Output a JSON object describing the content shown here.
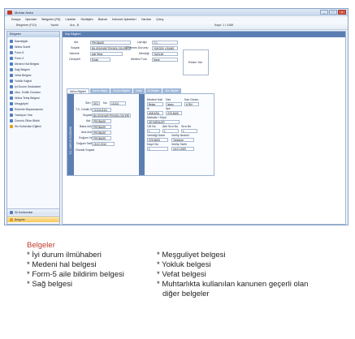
{
  "window": {
    "title": "Muhtar Arsivi",
    "min_label": "_",
    "max_label": "□",
    "close_label": "x"
  },
  "menu": [
    "Dosya",
    "İşlemler",
    "Belgeler (F6)",
    "Listeler",
    "Sicilişlim",
    "Bakım",
    "İnternet İşlemleri",
    "Yardım",
    "Çıkış"
  ],
  "toolbar": {
    "item1": "Belgelere (F10)",
    "item2": "Yazdır",
    "item3": "Ara - B",
    "record": "Kayıt: 1 / 4189"
  },
  "left_pane": {
    "title": "Belgeler",
    "items": [
      "İkametgah",
      "Nüfus Sureti",
      "Form-5",
      "Form-2",
      "Medeni Hal Belgesi",
      "Sağ Belgesi",
      "Vefat Belgesi",
      "Yoklük Kağıdı",
      "İyi Durum İlmuhaberi",
      "Ulus. Evlilik Cüzdanı",
      "Nüfus Tebiş Belgesi",
      "Meşguliyet",
      "Erkenlie Beyannamesi",
      "Yardayıcı Yazı",
      "Zorunlu Ölüm Bildiri",
      "Sin Kullanılan Eğitimi"
    ],
    "bottom1": "Sil Kullanımlar",
    "bottom2": "Belgeler"
  },
  "main": {
    "header": "Kişi Bilgileri",
    "labels": {
      "ad": "Adı",
      "soyadi": "Soyadı",
      "yakinlik": "Yakınlık",
      "cinsiyeti": "Cinsiyeti",
      "uyruk": "Uyruğu",
      "ogrenim": "Öğrenim Durumu",
      "meslek": "Mesleği",
      "medeni": "Medeni Turu"
    },
    "values": {
      "ad": "PROBASE",
      "soyadi": "BİLGİSAYAR/TEKNOLOJİLERİ",
      "yakinlik": "Aile Reisi",
      "cinsiyeti": "Erkek",
      "uyruk": "T.C.",
      "ogrenim": "YÜKSEK LİSANS",
      "meslek": "YAZILIM",
      "medeni": "Hane"
    },
    "photo_label": "Resim Yok",
    "tabs": [
      "Nüfus Bilgileri",
      "Adres Bilgisi",
      "Seçim Bilgileri",
      "Vefat",
      "Ek Bilgiler",
      "Aile Bilgileri"
    ]
  },
  "nufus": {
    "strip_left": "T.C. NÜFUS CÜZDANI",
    "labels": {
      "seri": "Seri",
      "no": "No",
      "tckimlik": "T.C. Kimlik No",
      "soyadi": "Soyadı",
      "adi": "Adı",
      "baba": "Baba Adı",
      "ana": "Ana Adı",
      "dogum_yeri": "Doğum Yeri",
      "dogum_tarihi": "Doğum Tarihi",
      "onceki": "Önceki Soyadı",
      "medeni": "Medeni Hali",
      "dini": "Dini",
      "kan": "Kan Grubu",
      "il": "İli",
      "ilce": "İlçe",
      "mahalle": "Mahalle / Köyü",
      "cilt": "Cilt No",
      "aile_sira": "Aile Sıra No",
      "sira": "Sıra No",
      "verildigi": "Verildiği Daire",
      "verilis": "Veriliş Nedeni",
      "kayit": "Kayıt No",
      "verilis_tarihi": "Veriliş Tarihi"
    },
    "values": {
      "seri": "G01",
      "no": "111111",
      "tckimlik": "11111111111",
      "soyadi": "BİLGİSAYAR/TEKNOLOJİLERİ",
      "adi": "PROBASE",
      "baba": "PROBASE",
      "ana": "PROBASE",
      "dogum_yeri": "PROBASE",
      "dogum_tarihi": "15.02.2010",
      "medeni": "Bekar",
      "dini": "İslam",
      "kan": "A Rh+",
      "il": "ANKARA",
      "ilce": "GÖLBAŞI",
      "mahalle": "SEYMENLER",
      "cilt": "1",
      "aile_sira": "1",
      "sira": "1",
      "verildigi": "GÖLBAŞI",
      "verilis": "Yenileme",
      "kayit": "1",
      "verilis_tarihi": "16.01.2009"
    }
  },
  "caption": {
    "heading": "Belgeler",
    "col1": [
      "* İyi durum ilmühaberi",
      "* Medeni hal belgesi",
      "* Form-5 aile bildirim belgesi",
      "* Sağ belgesi"
    ],
    "col2": [
      "* Meşguliyet belgesi",
      "* Yokluk belgesi",
      "* Vefat belgesi",
      "* Muhtarlıkta kullanılan kanunen geçerli olan",
      "diğer belgeler"
    ]
  }
}
